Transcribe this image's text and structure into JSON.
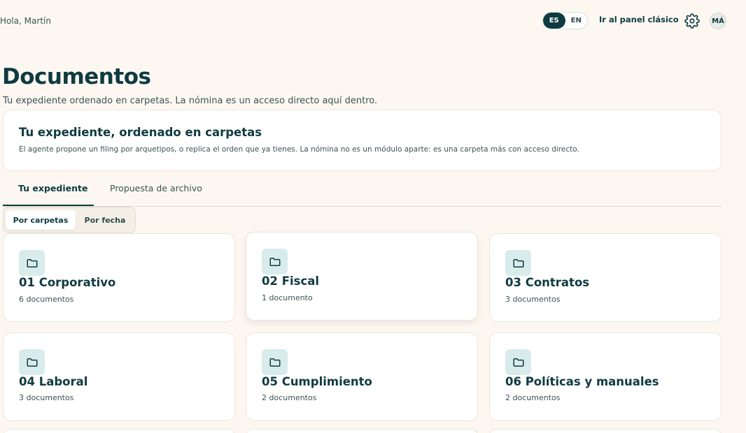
{
  "header": {
    "greeting": "Hola, Martín",
    "languages": [
      "ES",
      "EN"
    ],
    "active_language": "ES",
    "classic_panel_link": "Ir al panel clásico",
    "settings_icon": "gear-icon",
    "avatar_initials": "MÁ"
  },
  "page": {
    "title": "Documentos",
    "subtitle": "Tu expediente ordenado en carpetas. La nómina es un acceso directo aquí dentro."
  },
  "banner": {
    "title": "Tu expediente, ordenado en carpetas",
    "text": "El agente propone un filing por arquetipos, o replica el orden que ya tienes. La nómina no es un módulo aparte: es una carpeta más con acceso directo."
  },
  "tabs": [
    {
      "label": "Tu expediente",
      "active": true
    },
    {
      "label": "Propuesta de archivo",
      "active": false
    }
  ],
  "view_toggle": [
    {
      "label": "Por carpetas",
      "active": true
    },
    {
      "label": "Por fecha",
      "active": false
    }
  ],
  "folders": [
    {
      "name": "01 Corporativo",
      "count": "6 documentos",
      "icon": "folder-icon"
    },
    {
      "name": "02 Fiscal",
      "count": "1 documento",
      "icon": "folder-icon"
    },
    {
      "name": "03 Contratos",
      "count": "3 documentos",
      "icon": "folder-icon"
    },
    {
      "name": "04 Laboral",
      "count": "3 documentos",
      "icon": "folder-icon"
    },
    {
      "name": "05 Cumplimiento",
      "count": "2 documentos",
      "icon": "folder-icon"
    },
    {
      "name": "06 Políticas y manuales",
      "count": "2 documentos",
      "icon": "folder-icon"
    }
  ],
  "colors": {
    "background": "#fcf8f1",
    "primary": "#0f3b40",
    "icon_tile": "#d9ecec"
  }
}
